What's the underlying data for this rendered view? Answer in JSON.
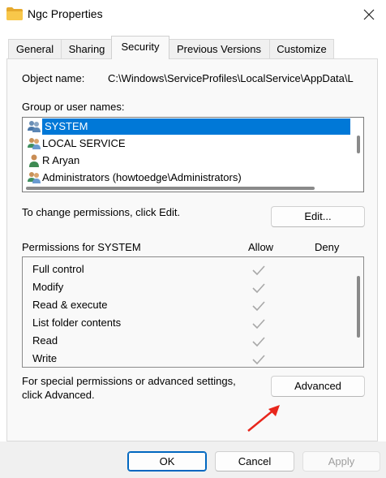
{
  "window": {
    "title": "Ngc Properties"
  },
  "tabs": [
    {
      "label": "General"
    },
    {
      "label": "Sharing"
    },
    {
      "label": "Security"
    },
    {
      "label": "Previous Versions"
    },
    {
      "label": "Customize"
    }
  ],
  "active_tab": "Security",
  "object": {
    "label": "Object name:",
    "value": "C:\\Windows\\ServiceProfiles\\LocalService\\AppData\\L"
  },
  "groups": {
    "label": "Group or user names:",
    "users": [
      {
        "name": "SYSTEM",
        "icon": "users-group-icon"
      },
      {
        "name": "LOCAL SERVICE",
        "icon": "users-group-icon"
      },
      {
        "name": "R Aryan",
        "icon": "user-icon"
      },
      {
        "name": "Administrators (howtoedge\\Administrators)",
        "icon": "users-group-icon"
      }
    ],
    "selected": "SYSTEM"
  },
  "change_hint": "To change permissions, click Edit.",
  "edit_button": "Edit...",
  "permissions": {
    "header_label": "Permissions for SYSTEM",
    "allow_label": "Allow",
    "deny_label": "Deny",
    "rows": [
      {
        "name": "Full control",
        "allow": true,
        "deny": false
      },
      {
        "name": "Modify",
        "allow": true,
        "deny": false
      },
      {
        "name": "Read & execute",
        "allow": true,
        "deny": false
      },
      {
        "name": "List folder contents",
        "allow": true,
        "deny": false
      },
      {
        "name": "Read",
        "allow": true,
        "deny": false
      },
      {
        "name": "Write",
        "allow": true,
        "deny": false
      }
    ]
  },
  "advanced_hint": {
    "line1": "For special permissions or advanced settings,",
    "line2": "click Advanced."
  },
  "advanced_button": "Advanced",
  "footer": {
    "ok": "OK",
    "cancel": "Cancel",
    "apply": "Apply"
  },
  "colors": {
    "selection": "#0078d7",
    "ok_border": "#0067c0",
    "arrow": "#e8261c"
  }
}
